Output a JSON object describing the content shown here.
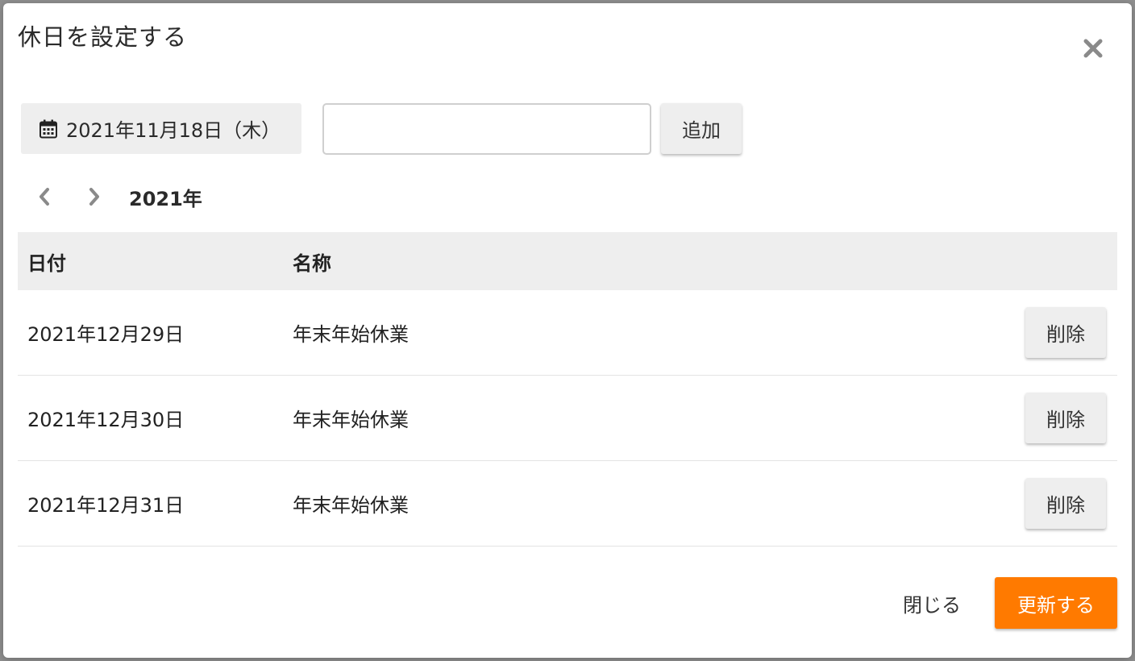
{
  "dialog": {
    "title": "休日を設定する"
  },
  "form": {
    "selected_date": "2021年11月18日（木）",
    "name_input_value": "",
    "add_label": "追加"
  },
  "year_nav": {
    "year_label": "2021年"
  },
  "table": {
    "headers": {
      "date": "日付",
      "name": "名称"
    },
    "rows": [
      {
        "date": "2021年12月29日",
        "name": "年末年始休業",
        "delete_label": "削除"
      },
      {
        "date": "2021年12月30日",
        "name": "年末年始休業",
        "delete_label": "削除"
      },
      {
        "date": "2021年12月31日",
        "name": "年末年始休業",
        "delete_label": "削除"
      }
    ]
  },
  "footer": {
    "close_label": "閉じる",
    "update_label": "更新する"
  },
  "colors": {
    "accent": "#ff7a00",
    "button_grey": "#eeeeee",
    "header_bg": "#eeeeee"
  },
  "icons": {
    "close": "close-icon",
    "calendar": "calendar-icon",
    "prev": "chevron-left-icon",
    "next": "chevron-right-icon"
  }
}
